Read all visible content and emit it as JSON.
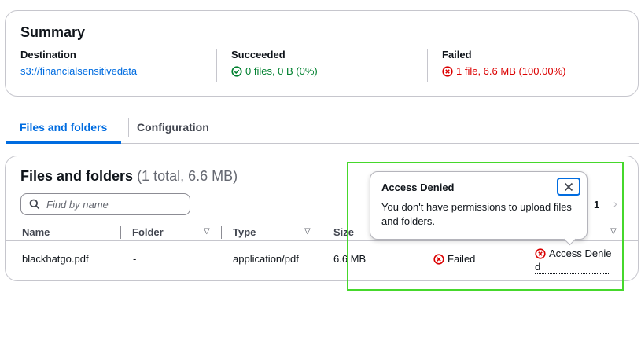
{
  "summary": {
    "title": "Summary",
    "destination": {
      "label": "Destination",
      "value": "s3://financialsensitivedata"
    },
    "succeeded": {
      "label": "Succeeded",
      "value": "0 files, 0 B (0%)"
    },
    "failed": {
      "label": "Failed",
      "value": "1 file, 6.6 MB (100.00%)"
    }
  },
  "tabs": [
    {
      "label": "Files and folders",
      "active": true
    },
    {
      "label": "Configuration",
      "active": false
    }
  ],
  "files": {
    "title": "Files and folders",
    "count": "(1 total, 6.6 MB)",
    "search_placeholder": "Find by name",
    "columns": [
      "Name",
      "Folder",
      "Type",
      "Size"
    ],
    "rows": [
      {
        "name": "blackhatgo.pdf",
        "folder": "-",
        "type": "application/pdf",
        "size": "6.6 MB",
        "status": "Failed",
        "error_line1": "Access Denie",
        "error_line2": "d"
      }
    ],
    "page": "1"
  },
  "popover": {
    "title": "Access Denied",
    "body": "You don't have permissions to upload files and folders."
  },
  "colors": {
    "link": "#006ce0",
    "success": "#00802f",
    "error": "#db0000",
    "highlight": "#46d82c"
  }
}
